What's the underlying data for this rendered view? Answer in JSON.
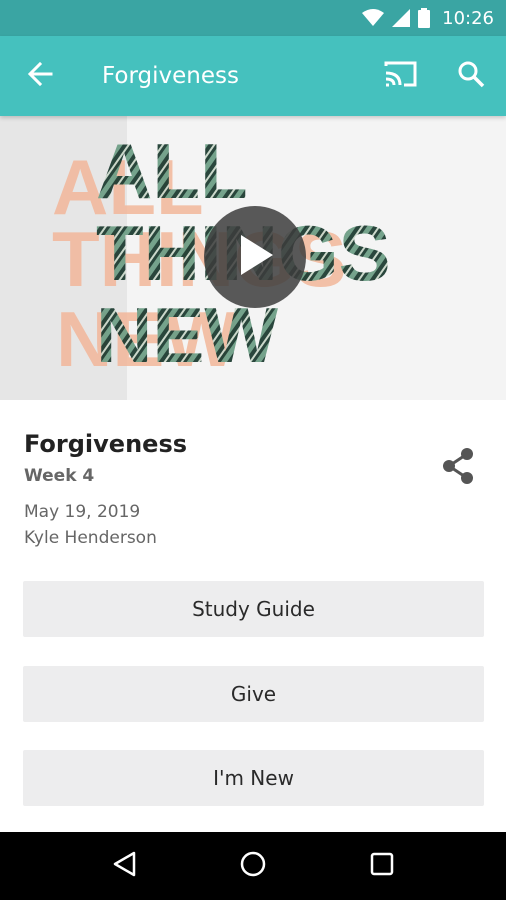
{
  "status_bar": {
    "time": "10:26",
    "icons": [
      "wifi-icon",
      "signal-icon",
      "battery-icon"
    ]
  },
  "app_bar": {
    "title": "Forgiveness",
    "icons": [
      "back-arrow-icon",
      "cast-icon",
      "search-icon"
    ],
    "color": "#45c1be"
  },
  "hero": {
    "artwork_text": [
      "ALL",
      "THINGS",
      "NEW"
    ],
    "artwork_color": "#f2b79a",
    "play_icon": "play-icon"
  },
  "sermon": {
    "title": "Forgiveness",
    "series_week": "Week 4",
    "date": "May 19, 2019",
    "speaker": "Kyle Henderson"
  },
  "actions": {
    "study_guide": "Study Guide",
    "give": "Give",
    "im_new": "I'm New"
  },
  "nav_bar": {
    "icons": [
      "back-triangle-icon",
      "home-circle-icon",
      "recents-square-icon"
    ]
  }
}
